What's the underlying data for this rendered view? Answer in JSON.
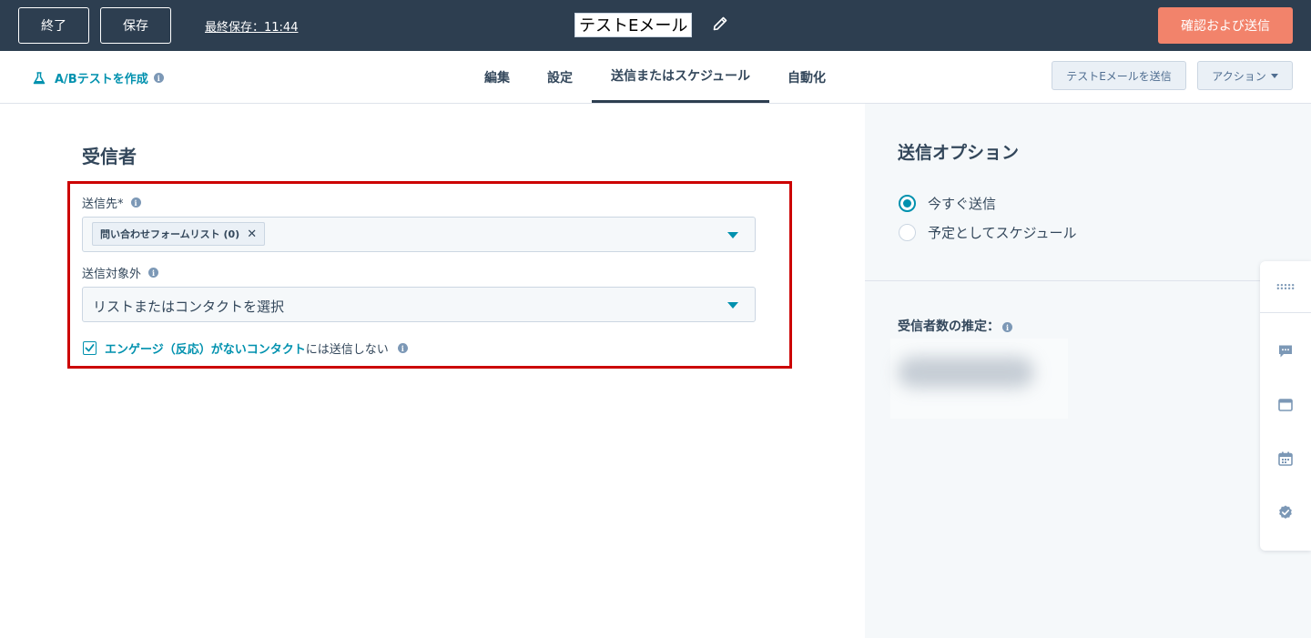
{
  "topbar": {
    "exit_label": "終了",
    "save_label": "保存",
    "last_saved": "最終保存：11:44",
    "email_name": "テストEメール",
    "review_send_label": "確認および送信"
  },
  "navbar": {
    "ab_test_label": "A/Bテストを作成",
    "tabs": [
      {
        "label": "編集"
      },
      {
        "label": "設定"
      },
      {
        "label": "送信またはスケジュール"
      },
      {
        "label": "自動化"
      }
    ],
    "active_tab": "送信またはスケジュール",
    "test_send_label": "テストEメールを送信",
    "actions_label": "アクション"
  },
  "recipients": {
    "title": "受信者",
    "send_to_label": "送信先*",
    "send_to_chip": "問い合わせフォームリスト (0)",
    "exclude_label": "送信対象外",
    "exclude_placeholder": "リストまたはコンタクトを選択",
    "unengaged_link": "エンゲージ（反応）がないコンタクト",
    "unengaged_suffix": "には送信しない",
    "unengaged_checked": true
  },
  "send_options": {
    "title": "送信オプション",
    "options": [
      {
        "label": "今すぐ送信",
        "selected": true
      },
      {
        "label": "予定としてスケジュール",
        "selected": false
      }
    ],
    "estimate_title": "受信者数の推定："
  },
  "colors": {
    "topbar_bg": "#2d3e50",
    "accent": "#0091ae",
    "primary_button": "#f2836b",
    "highlight_border": "#cc0000"
  },
  "icons": {
    "pencil": "pencil-icon",
    "flask": "flask-icon",
    "info": "info-icon",
    "close": "close-icon",
    "caret": "chevron-down-icon",
    "checkbox": "checkmark-icon",
    "float_bar": [
      "grid-icon",
      "chat-icon",
      "window-icon",
      "calendar-icon",
      "verified-check-icon"
    ]
  }
}
